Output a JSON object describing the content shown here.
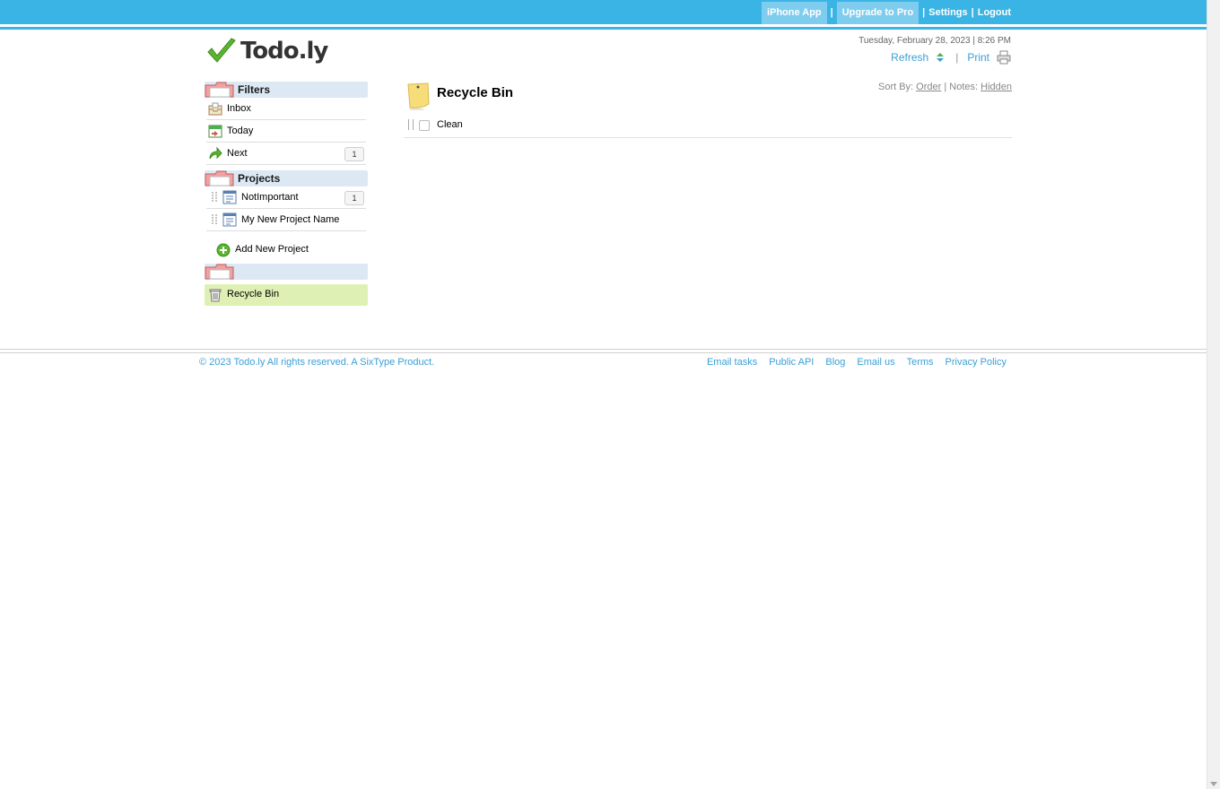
{
  "topnav": {
    "iphone_app": "iPhone App",
    "sep1": "|",
    "upgrade": "Upgrade to Pro",
    "sep2": "|",
    "settings": "Settings",
    "sep3": "|",
    "logout": "Logout"
  },
  "header": {
    "logo_text": "Todo.ly",
    "datetime": "Tuesday, February 28, 2023 | 8:26 PM",
    "refresh": "Refresh",
    "sep": "|",
    "print": "Print"
  },
  "sidebar": {
    "filters_title": "Filters",
    "filters": [
      {
        "label": "Inbox",
        "count": ""
      },
      {
        "label": "Today",
        "count": ""
      },
      {
        "label": "Next",
        "count": "1"
      }
    ],
    "projects_title": "Projects",
    "projects": [
      {
        "label": "NotImportant",
        "count": "1"
      },
      {
        "label": "My New Project Name",
        "count": ""
      }
    ],
    "add_project": "Add New Project",
    "recycle_bin": "Recycle Bin"
  },
  "main": {
    "title": "Recycle Bin",
    "sort_label": "Sort By:",
    "sort_value": "Order",
    "notes_sep": "| Notes:",
    "notes_value": "Hidden",
    "tasks": [
      {
        "label": "Clean"
      }
    ]
  },
  "footer": {
    "copyright": "© 2023 Todo.ly All rights reserved. A SixType Product.",
    "links": [
      "Email tasks",
      "Public API",
      "Blog",
      "Email us",
      "Terms",
      "Privacy Policy"
    ]
  },
  "colors": {
    "accent": "#3ab4e4",
    "link": "#3a9fd6",
    "section_bg": "#dce9f4",
    "selected_bg": "#dff0b4"
  }
}
